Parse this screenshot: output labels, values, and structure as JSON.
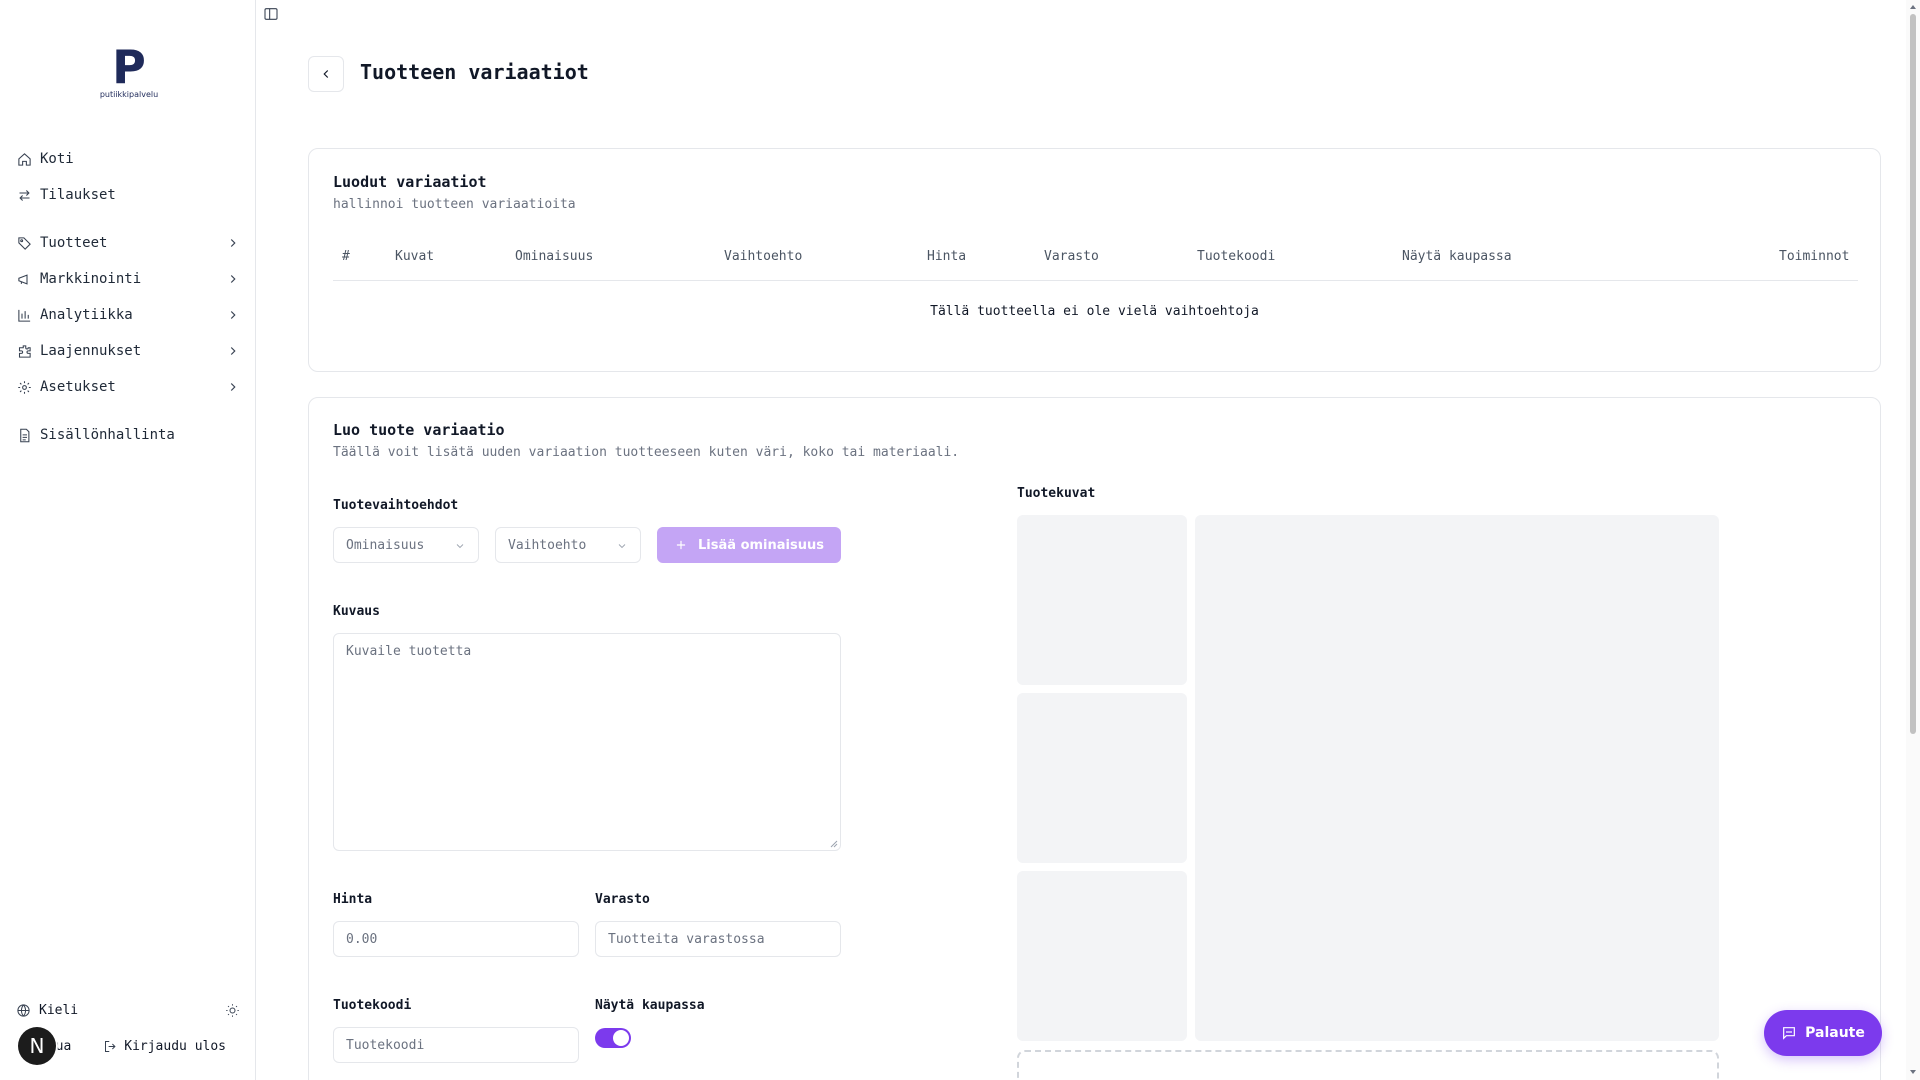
{
  "logo": {
    "mark": "P",
    "text": "putiikkipalvelu"
  },
  "sidebar": {
    "items": [
      {
        "label": "Koti",
        "icon": "home-icon"
      },
      {
        "label": "Tilaukset",
        "icon": "arrows-icon"
      },
      {
        "label": "Tuotteet",
        "icon": "tag-icon"
      },
      {
        "label": "Markkinointi",
        "icon": "megaphone-icon"
      },
      {
        "label": "Analytiikka",
        "icon": "chart-icon"
      },
      {
        "label": "Laajennukset",
        "icon": "puzzle-icon"
      },
      {
        "label": "Asetukset",
        "icon": "gear-icon"
      },
      {
        "label": "Sisällönhallinta",
        "icon": "document-icon"
      }
    ],
    "language_label": "Kieli",
    "help_label": "Apua",
    "logout_label": "Kirjaudu ulos",
    "avatar_letter": "N"
  },
  "header": {
    "title": "Tuotteen variaatiot"
  },
  "variations": {
    "title": "Luodut variaatiot",
    "subtitle": "hallinnoi tuotteen variaatioita",
    "columns": [
      "#",
      "Kuvat",
      "Ominaisuus",
      "Vaihtoehto",
      "Hinta",
      "Varasto",
      "Tuotekoodi",
      "Näytä kaupassa",
      "Toiminnot"
    ],
    "empty_message": "Tällä tuotteella ei ole vielä vaihtoehtoja"
  },
  "create": {
    "title": "Luo tuote variaatio",
    "subtitle": "Täällä voit lisätä uuden variaation tuotteeseen kuten väri, koko tai materiaali.",
    "options_label": "Tuotevaihtoehdot",
    "attribute_placeholder": "Ominaisuus",
    "option_placeholder": "Vaihtoehto",
    "add_attribute_label": "Lisää ominaisuus",
    "description_label": "Kuvaus",
    "description_placeholder": "Kuvaile tuotetta",
    "price_label": "Hinta",
    "price_placeholder": "0.00",
    "stock_label": "Varasto",
    "stock_placeholder": "Tuotteita varastossa",
    "sku_label": "Tuotekoodi",
    "sku_placeholder": "Tuotekoodi",
    "show_in_store_label": "Näytä kaupassa",
    "show_in_store": true,
    "images_label": "Tuotekuvat"
  },
  "feedback": {
    "label": "Palaute"
  },
  "colors": {
    "accent": "#7c3aed",
    "accent_disabled": "#c4a5f5",
    "border": "#e5e7eb"
  }
}
